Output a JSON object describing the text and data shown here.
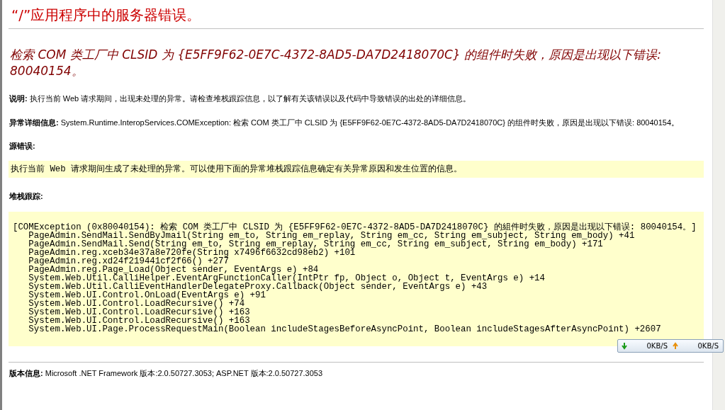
{
  "title": "“/”应用程序中的服务器错误。",
  "error_message": "检索 COM 类工厂中 CLSID 为 {E5FF9F62-0E7C-4372-8AD5-DA7D2418070C} 的组件时失败，原因是出现以下错误: 80040154。",
  "description": "**说明:** 执行当前 Web 请求期间，出现未处理的异常。请检查堆栈跟踪信息，以了解有关该错误以及代码中导致错误的出处的详细信息。",
  "exception_details": "**异常详细信息:** System.Runtime.InteropServices.COMException: 检索 COM 类工厂中 CLSID 为 {E5FF9F62-0E7C-4372-8AD5-DA7D2418070C} 的组件时失败，原因是出现以下错误: 80040154。",
  "source_error": {
    "label": "源错误:",
    "message": "执行当前 Web 请求期间生成了未处理的异常。可以使用下面的异常堆栈跟踪信息确定有关异常原因和发生位置的信息。"
  },
  "stack_trace": {
    "label": "堆栈跟踪:",
    "exception": "[COMException (0x80040154): 检索 COM 类工厂中 CLSID 为 {E5FF9F62-0E7C-4372-8AD5-DA7D2418070C} 的組件时失败，原因是出现以下错误: 80040154。]",
    "frames": [
      "PageAdmin.SendMail.SendByJmail(String em_to, String em_replay, String em_cc, String em_subject, String em_body) +41",
      "PageAdmin.SendMail.Send(String em_to, String em_replay, String em_cc, String em_subject, String em_body) +171",
      "PageAdmin.reg.xceb34e37a8e720fe(String x7496f6632cd98eb2) +101",
      "PageAdmin.reg.xd24f219441cf2f66() +277",
      "PageAdmin.reg.Page_Load(Object sender, EventArgs e) +84",
      "System.Web.Util.CalliHelper.EventArgFunctionCaller(IntPtr fp, Object o, Object t, EventArgs e) +14",
      "System.Web.Util.CalliEventHandlerDelegateProxy.Callback(Object sender, EventArgs e) +43",
      "System.Web.UI.Control.OnLoad(EventArgs e) +91",
      "System.Web.UI.Control.LoadRecursive() +74",
      "System.Web.UI.Control.LoadRecursive() +163",
      "System.Web.UI.Control.LoadRecursive() +163",
      "System.Web.UI.Page.ProcessRequestMain(Boolean includeStagesBeforeAsyncPoint, Boolean includeStagesAfterAsyncPoint) +2607"
    ]
  },
  "version": "**版本信息:** Microsoft .NET Framework 版本:2.0.50727.3053; ASP.NET 版本:2.0.50727.3053",
  "net_speed": {
    "download": "0KB/S",
    "upload": "0KB/S"
  }
}
